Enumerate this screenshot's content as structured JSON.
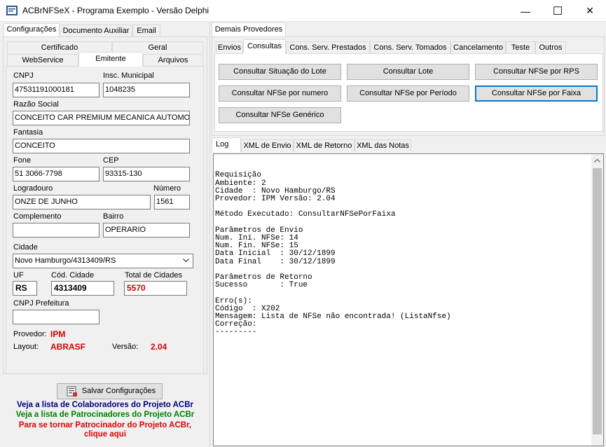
{
  "window": {
    "title": "ACBrNFSeX - Programa Exemplo - Versão Delphi",
    "min_glyph": "—",
    "max_glyph": "☐",
    "close_glyph": "✕"
  },
  "left_tabs": {
    "configuracoes": "Configurações",
    "doc_auxiliar": "Documento Auxiliar",
    "email": "Email"
  },
  "sub_tabs": {
    "certificado": "Certificado",
    "geral": "Geral",
    "webservice": "WebService",
    "emitente": "Emitente",
    "arquivos": "Arquivos"
  },
  "emitente": {
    "cnpj_label": "CNPJ",
    "cnpj": "47531191000181",
    "insc_label": "Insc. Municipal",
    "insc": "1048235",
    "razao_label": "Razão Social",
    "razao": "CONCEITO CAR PREMIUM MECANICA AUTOMOTIV.",
    "fantasia_label": "Fantasia",
    "fantasia": "CONCEITO",
    "fone_label": "Fone",
    "fone": "51 3066-7798",
    "cep_label": "CEP",
    "cep": "93315-130",
    "logradouro_label": "Logradouro",
    "logradouro": "ONZE DE JUNHO",
    "numero_label": "Número",
    "numero": "1561",
    "complemento_label": "Complemento",
    "complemento": "",
    "bairro_label": "Bairro",
    "bairro": "OPERARIO",
    "cidade_label": "Cidade",
    "cidade": "Novo Hamburgo/4313409/RS",
    "uf_label": "UF",
    "uf": "RS",
    "cod_cidade_label": "Cód. Cidade",
    "cod_cidade": "4313409",
    "total_cidades_label": "Total de Cidades",
    "total_cidades": "5570",
    "cnpj_pref_label": "CNPJ Prefeitura",
    "cnpj_pref": "",
    "provedor_label": "Provedor:",
    "provedor": "IPM",
    "layout_label": "Layout:",
    "layout": "ABRASF",
    "versao_label": "Versão:",
    "versao": "2.04"
  },
  "footer": {
    "salvar": "Salvar Configurações",
    "colaboradores": "Veja a lista de Colaboradores do Projeto ACBr",
    "patrocinadores": "Veja a lista de Patrocinadores do Projeto ACBr",
    "tornar_line1": "Para se tornar Patrocinador do Projeto ACBr,",
    "tornar_line2": "clique aqui"
  },
  "right": {
    "demais_provedores": "Demais Provedores",
    "tabs": {
      "envios": "Envios",
      "consultas": "Consultas",
      "prestados": "Cons. Serv. Prestados",
      "tomados": "Cons. Serv. Tomados",
      "cancelamento": "Cancelamento",
      "teste": "Teste",
      "outros": "Outros"
    },
    "buttons": {
      "situacao_lote": "Consultar Situação do Lote",
      "lote": "Consultar Lote",
      "por_rps": "Consultar NFSe por RPS",
      "por_numero": "Consultar NFSe por numero",
      "por_periodo": "Consultar NFSe por Período",
      "por_faixa": "Consultar NFSe por Faixa",
      "generico": "Consultar NFSe Genérico"
    },
    "log_tabs": {
      "log": "Log",
      "xml_envio": "XML de Envio",
      "xml_retorno": "XML de Retorno",
      "xml_notas": "XML das Notas"
    },
    "log_text": "Requisição\nAmbiente: 2\nCidade  : Novo Hamburgo/RS\nProvedor: IPM Versão: 2.04\n\nMétodo Executado: ConsultarNFSePorFaixa\n\nParâmetros de Envio\nNum. Ini. NFSe: 14\nNum. Fin. NFSe: 15\nData Inicial  : 30/12/1899\nData Final    : 30/12/1899\n\nParâmetros de Retorno\nSucesso       : True\n\nErro(s):\nCódigo  : X202\nMensagem: Lista de NFSe não encontrada! (ListaNfse)\nCorreção:\n---------"
  }
}
